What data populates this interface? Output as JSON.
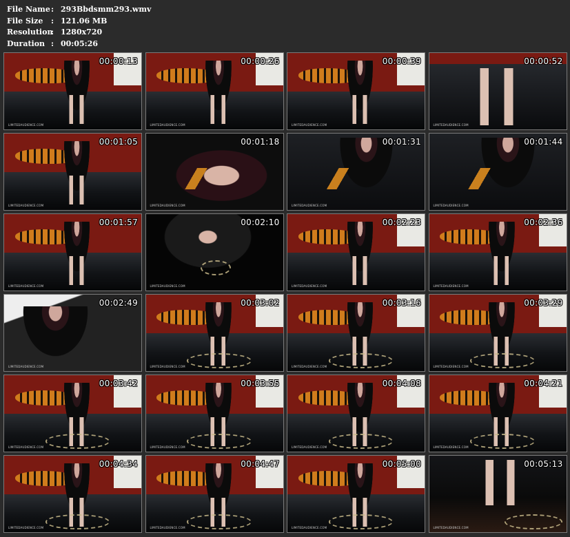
{
  "info": [
    {
      "key": "File Name",
      "value": "293Bbdsmm293.wmv"
    },
    {
      "key": "File Size",
      "value": "121.06 MB"
    },
    {
      "key": "Resolution",
      "value": "1280x720"
    },
    {
      "key": "Duration",
      "value": "00:05:26"
    }
  ],
  "watermark": "LIMITEDAUDIENCE.COM",
  "thumbnails": [
    {
      "time": "00:00:13",
      "scene": "room"
    },
    {
      "time": "00:00:26",
      "scene": "room"
    },
    {
      "time": "00:00:39",
      "scene": "room"
    },
    {
      "time": "00:00:52",
      "scene": "legs"
    },
    {
      "time": "00:01:05",
      "scene": "room-tiger"
    },
    {
      "time": "00:01:18",
      "scene": "closeup"
    },
    {
      "time": "00:01:31",
      "scene": "chair"
    },
    {
      "time": "00:01:44",
      "scene": "chair"
    },
    {
      "time": "00:01:57",
      "scene": "room-tiger"
    },
    {
      "time": "00:02:10",
      "scene": "closeup-dark"
    },
    {
      "time": "00:02:23",
      "scene": "room"
    },
    {
      "time": "00:02:36",
      "scene": "room"
    },
    {
      "time": "00:02:49",
      "scene": "sofa-close"
    },
    {
      "time": "00:03:02",
      "scene": "room-window"
    },
    {
      "time": "00:03:16",
      "scene": "room-window"
    },
    {
      "time": "00:03:29",
      "scene": "room-window"
    },
    {
      "time": "00:03:42",
      "scene": "room-window"
    },
    {
      "time": "00:03:55",
      "scene": "room-window"
    },
    {
      "time": "00:04:08",
      "scene": "room-window"
    },
    {
      "time": "00:04:21",
      "scene": "room-window"
    },
    {
      "time": "00:04:34",
      "scene": "room-window"
    },
    {
      "time": "00:04:47",
      "scene": "room-window"
    },
    {
      "time": "00:05:00",
      "scene": "room-window"
    },
    {
      "time": "00:05:13",
      "scene": "floor-rope"
    }
  ],
  "colors": {
    "background": "#2b2b2b",
    "text": "#ffffff",
    "wall_red": "#7a1a12",
    "tiger_orange": "#d07c1c",
    "sofa_black": "#111316"
  }
}
